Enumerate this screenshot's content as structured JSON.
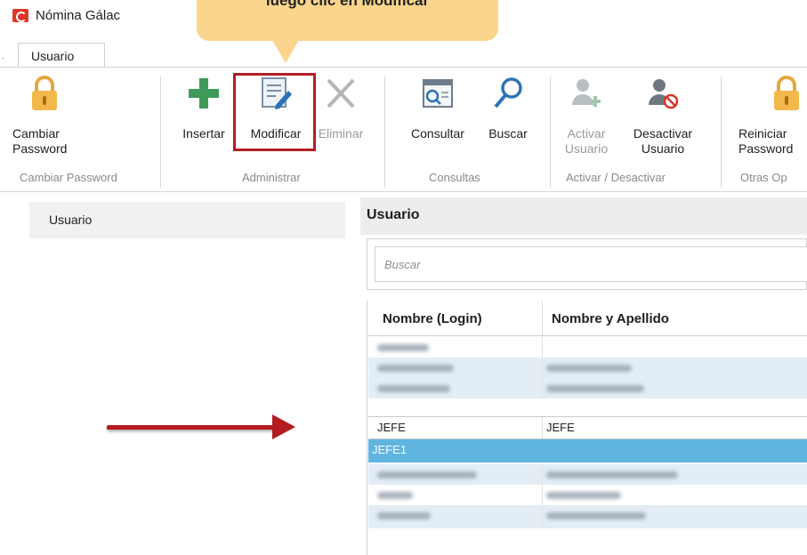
{
  "window": {
    "title": "Nómina Gálac"
  },
  "callout": {
    "text": "luego clic en Modificar"
  },
  "tabs": [
    {
      "label": "Usuario"
    }
  ],
  "ribbon": {
    "buttons": [
      {
        "label_line1": "Cambiar",
        "label_line2": "Password",
        "icon": "lock-icon",
        "enabled": true
      },
      {
        "label_line1": "Insertar",
        "label_line2": "",
        "icon": "plus-icon",
        "enabled": true
      },
      {
        "label_line1": "Modificar",
        "label_line2": "",
        "icon": "edit-document-icon",
        "enabled": true
      },
      {
        "label_line1": "Eliminar",
        "label_line2": "",
        "icon": "close-x-icon",
        "enabled": false
      },
      {
        "label_line1": "Consultar",
        "label_line2": "",
        "icon": "window-search-icon",
        "enabled": true
      },
      {
        "label_line1": "Buscar",
        "label_line2": "",
        "icon": "search-icon",
        "enabled": true
      },
      {
        "label_line1": "Activar",
        "label_line2": "Usuario",
        "icon": "user-add-icon",
        "enabled": false
      },
      {
        "label_line1": "Desactivar",
        "label_line2": "Usuario",
        "icon": "user-block-icon",
        "enabled": true
      },
      {
        "label_line1": "Reiniciar",
        "label_line2": "Password",
        "icon": "lock-icon",
        "enabled": true
      }
    ],
    "groups": [
      {
        "label": "Cambiar Password"
      },
      {
        "label": "Administrar"
      },
      {
        "label": "Consultas"
      },
      {
        "label": "Activar / Desactivar"
      },
      {
        "label": "Otras Op"
      }
    ]
  },
  "nav": {
    "items": [
      {
        "label": "Usuario"
      }
    ]
  },
  "panel": {
    "title": "Usuario",
    "search_placeholder": "Buscar",
    "columns": [
      "Nombre (Login)",
      "Nombre y Apellido"
    ],
    "rows": [
      {
        "login": "",
        "name": "",
        "blurred": true
      },
      {
        "login": "",
        "name": "",
        "blurred": true
      },
      {
        "login": "",
        "name": "",
        "blurred": true
      },
      {
        "login": "JEFE",
        "name": "JEFE",
        "blurred": false
      },
      {
        "login": "JEFE1",
        "name": "",
        "blurred": false,
        "selected": true
      },
      {
        "login": "",
        "name": "",
        "blurred": true
      },
      {
        "login": "",
        "name": "",
        "blurred": true
      },
      {
        "login": "",
        "name": "",
        "blurred": true
      }
    ]
  },
  "colors": {
    "accent_red": "#b21f24",
    "selected_row": "#5fb4e0",
    "callout_bg": "#fbd58d"
  }
}
